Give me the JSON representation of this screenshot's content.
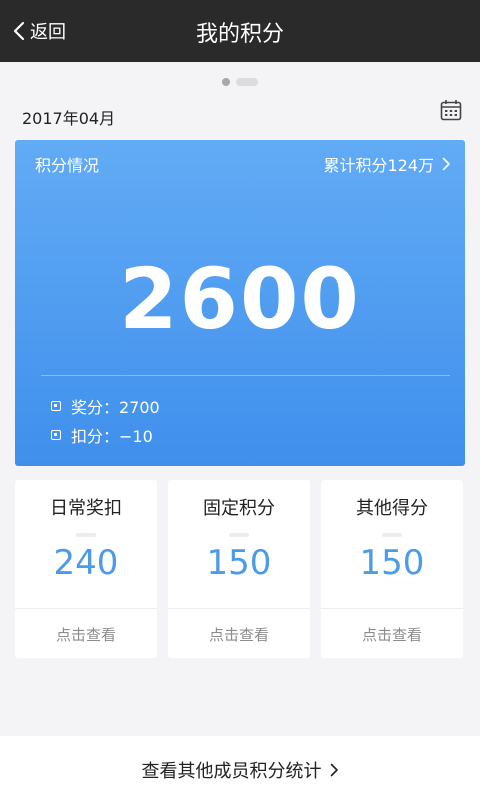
{
  "nav": {
    "back_label": "返回",
    "title": "我的积分"
  },
  "month": "2017年04月",
  "score_card": {
    "label": "积分情况",
    "total_label": "累计积分124万",
    "score": "2600",
    "bonus": "奖分：2700",
    "deduct": "扣分：−10"
  },
  "categories": [
    {
      "title": "日常奖扣",
      "value": "240",
      "link": "点击查看"
    },
    {
      "title": "固定积分",
      "value": "150",
      "link": "点击查看"
    },
    {
      "title": "其他得分",
      "value": "150",
      "link": "点击查看"
    }
  ],
  "bottom": {
    "more_label": "查看其他成员积分统计"
  },
  "colors": {
    "nav_bg": "#2a2a2a",
    "card_blue_top": "#62abf5",
    "card_blue_bottom": "#3f8fec",
    "value_blue": "#4b9be8"
  }
}
